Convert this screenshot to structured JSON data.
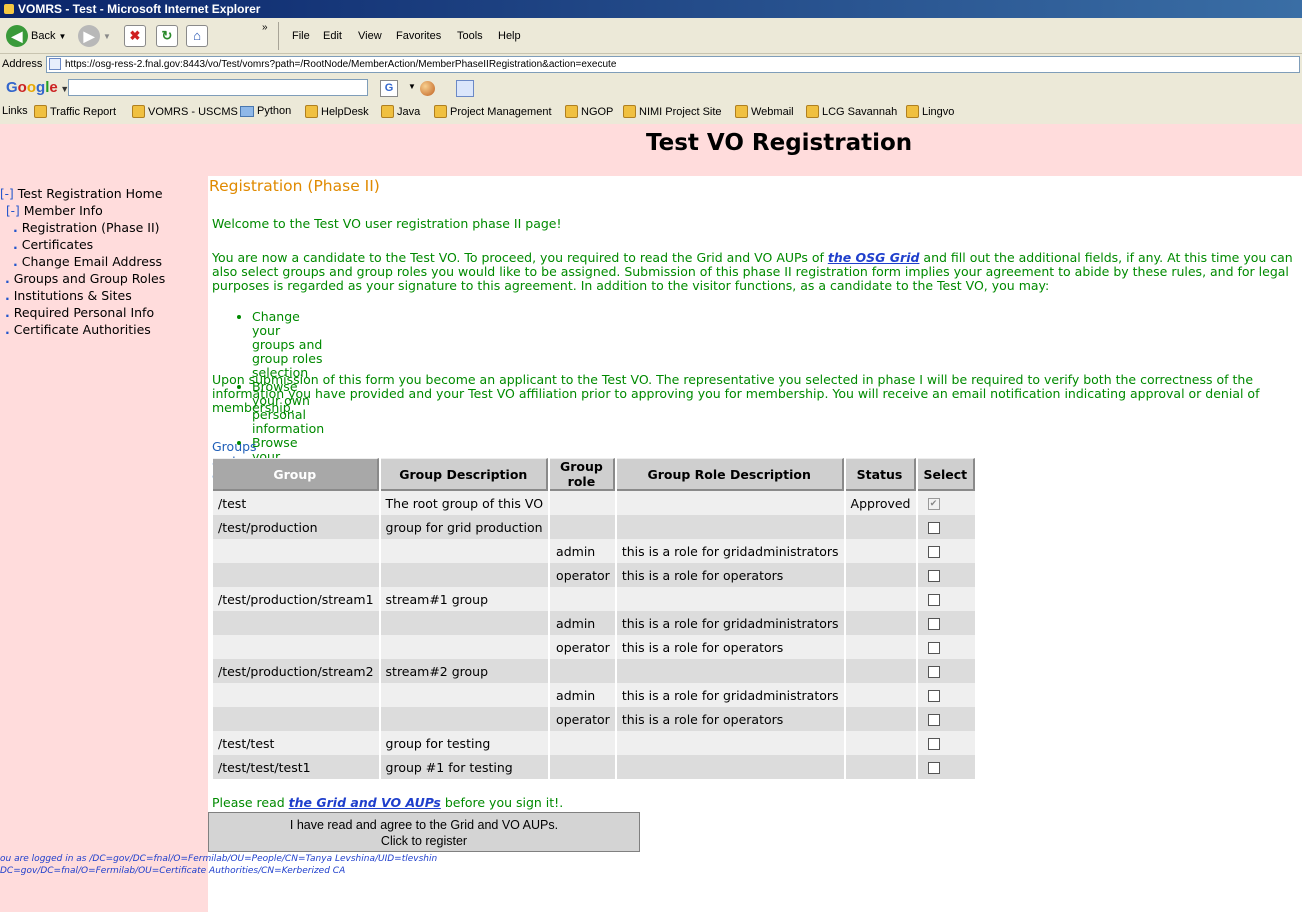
{
  "window": {
    "title": "VOMRS - Test - Microsoft Internet Explorer"
  },
  "toolbar": {
    "back_label": "Back",
    "menu": [
      "File",
      "Edit",
      "View",
      "Favorites",
      "Tools",
      "Help"
    ]
  },
  "address": {
    "label": "Address",
    "url": "https://osg-ress-2.fnal.gov:8443/vo/Test/vomrs?path=/RootNode/MemberAction/MemberPhaseIIRegistration&action=execute"
  },
  "google": {
    "logo": "Google"
  },
  "links": {
    "label": "Links",
    "items": [
      "Traffic Report",
      "VOMRS - USCMS",
      "Python",
      "HelpDesk",
      "Java",
      "Project Management",
      "NGOP",
      "NIMI Project Site",
      "Webmail",
      "LCG Savannah",
      "Lingvo"
    ]
  },
  "page": {
    "title": "Test VO Registration"
  },
  "nav": {
    "home": "Test Registration Home",
    "member_info": "Member Info",
    "items": [
      "Registration (Phase II)",
      "Certificates",
      "Change Email Address",
      "Groups and Group Roles",
      "Institutions & Sites",
      "Required Personal Info",
      "Certificate Authorities"
    ],
    "toggle": "[-]"
  },
  "main": {
    "phase_title": "Registration (Phase II)",
    "welcome": "Welcome to the Test VO user registration phase II page!",
    "intro_before": "You are now a candidate to the Test VO. To proceed, you required to read the Grid and VO AUPs of ",
    "intro_link": "the OSG Grid",
    "intro_after": " and fill out the additional fields, if any. At this time you can also select groups and group roles you would like to be assigned. Submission of this phase II registration form implies your agreement to abide by these rules, and for legal purposes is regarded as your signature to this agreement. In addition to the visitor functions, as a candidate to the Test VO, you may:",
    "bullets": [
      "Change your groups and group roles selection",
      "Browse your own personal information",
      "Browse your certificate information"
    ],
    "submission": "Upon submission of this form you become an applicant to the Test VO. The representative you selected in phase I will be required to verify both the correctness of the information you have provided and your Test VO affiliation prior to approving you for membership. You will receive an email notification indicating approval or denial of membership.",
    "groups_title": "Groups and Group Roles:",
    "read_before": "Please read ",
    "read_link": "the Grid and VO AUPs",
    "read_after": " before you sign it!.",
    "register_line1": "I have read and agree to the Grid and VO AUPs.",
    "register_line2": "Click to register"
  },
  "table": {
    "headers": [
      "Group",
      "Group Description",
      "Group role",
      "Group Role Description",
      "Status",
      "Select"
    ],
    "rows": [
      {
        "group": "/test",
        "desc": "The root group of this VO",
        "role": "",
        "role_desc": "",
        "status": "Approved",
        "checked": true
      },
      {
        "group": "/test/production",
        "desc": "group for grid production",
        "role": "",
        "role_desc": "",
        "status": "",
        "checked": false
      },
      {
        "group": "",
        "desc": "",
        "role": "admin",
        "role_desc": "this is a role for gridadministrators",
        "status": "",
        "checked": false
      },
      {
        "group": "",
        "desc": "",
        "role": "operator",
        "role_desc": "this is a role for operators",
        "status": "",
        "checked": false
      },
      {
        "group": "/test/production/stream1",
        "desc": "stream#1 group",
        "role": "",
        "role_desc": "",
        "status": "",
        "checked": false
      },
      {
        "group": "",
        "desc": "",
        "role": "admin",
        "role_desc": "this is a role for gridadministrators",
        "status": "",
        "checked": false
      },
      {
        "group": "",
        "desc": "",
        "role": "operator",
        "role_desc": "this is a role for operators",
        "status": "",
        "checked": false
      },
      {
        "group": "/test/production/stream2",
        "desc": "stream#2 group",
        "role": "",
        "role_desc": "",
        "status": "",
        "checked": false
      },
      {
        "group": "",
        "desc": "",
        "role": "admin",
        "role_desc": "this is a role for gridadministrators",
        "status": "",
        "checked": false
      },
      {
        "group": "",
        "desc": "",
        "role": "operator",
        "role_desc": "this is a role for operators",
        "status": "",
        "checked": false
      },
      {
        "group": "/test/test",
        "desc": "group for testing",
        "role": "",
        "role_desc": "",
        "status": "",
        "checked": false
      },
      {
        "group": "/test/test/test1",
        "desc": "group #1 for testing",
        "role": "",
        "role_desc": "",
        "status": "",
        "checked": false
      }
    ]
  },
  "footer": {
    "line1": "ou are logged in as /DC=gov/DC=fnal/O=Fermilab/OU=People/CN=Tanya Levshina/UID=tlevshin",
    "line2": "DC=gov/DC=fnal/O=Fermilab/OU=Certificate Authorities/CN=Kerberized CA"
  }
}
